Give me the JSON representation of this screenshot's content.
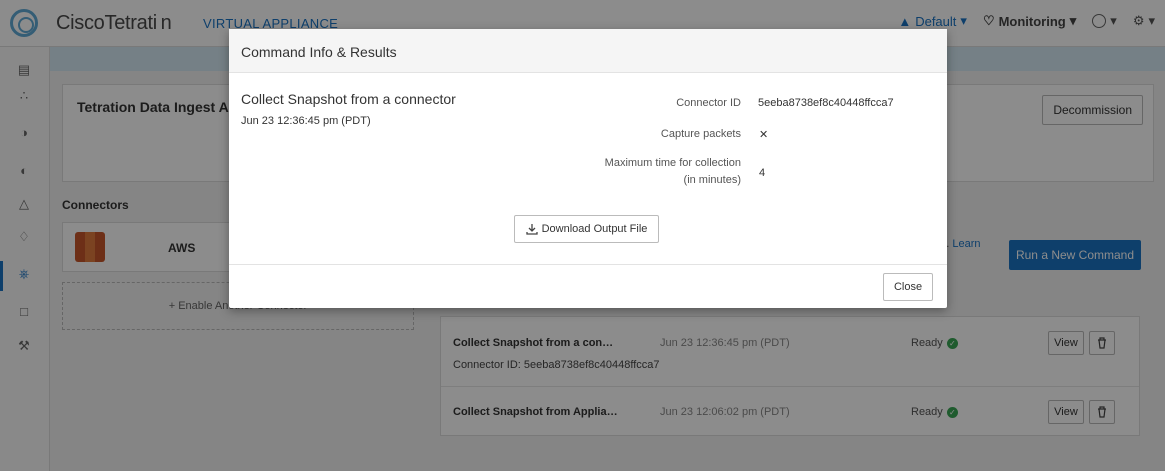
{
  "app": {
    "brand": "CiscoTetrati n",
    "brand_sub": "VIRTUAL APPLIANCE",
    "scope": "Default",
    "monitoring": "Monitoring",
    "help_icon": "help-icon",
    "settings_icon": "gear-icon"
  },
  "sidebar": {
    "icons": [
      "chart-icon",
      "topology-icon",
      "shield-icon",
      "dashboard-icon",
      "flask-icon",
      "alert-icon",
      "plug-icon",
      "bank-icon",
      "wrench-icon"
    ]
  },
  "page": {
    "card_title": "Tetration Data Ingest Appliance",
    "decommission": "Decommission",
    "connectors_label": "Connectors",
    "aws_name": "AWS",
    "enable_connector": "+ Enable Another Connector",
    "learn_prefix": "ng.",
    "learn_link": "Learn",
    "run_command": "Run a New Command"
  },
  "results": [
    {
      "title": "Collect Snapshot from a con…",
      "time": "Jun 23 12:36:45 pm (PDT)",
      "status": "Ready",
      "sub": "Connector ID: 5eeba8738ef8c40448ffcca7",
      "view": "View"
    },
    {
      "title": "Collect Snapshot from Applia…",
      "time": "Jun 23 12:06:02 pm (PDT)",
      "status": "Ready",
      "view": "View"
    }
  ],
  "modal": {
    "title": "Command Info & Results",
    "command_title": "Collect Snapshot from a connector",
    "command_time": "Jun 23 12:36:45 pm (PDT)",
    "fields": {
      "connector_id_label": "Connector ID",
      "connector_id_value": "5eeba8738ef8c40448ffcca7",
      "capture_packets_label": "Capture packets",
      "capture_packets_value": "✕",
      "max_time_label_1": "Maximum time for collection",
      "max_time_label_2": "(in minutes)",
      "max_time_value": "4"
    },
    "download": "Download Output File",
    "close": "Close"
  },
  "colors": {
    "accent": "#1a73c4",
    "ready": "#3aa655"
  }
}
